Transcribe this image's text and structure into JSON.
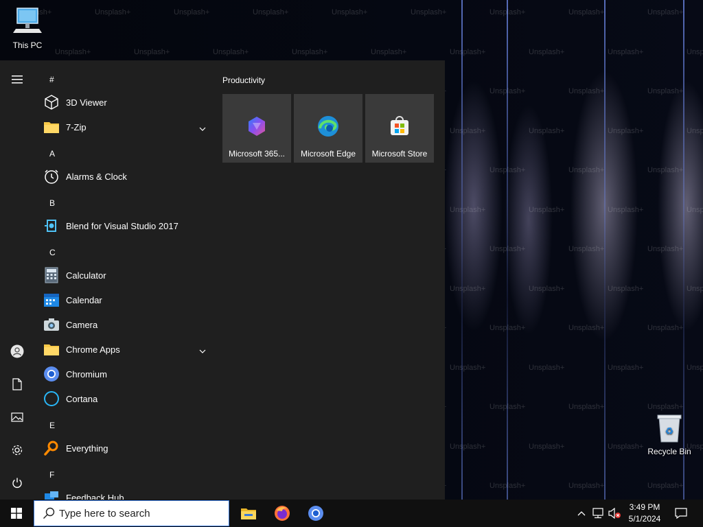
{
  "desktop": {
    "icons": [
      {
        "label": "This PC"
      },
      {
        "label": "Recycle Bin"
      }
    ],
    "watermark_text": "Unsplash+"
  },
  "start_menu": {
    "rail": [
      "hamburger-menu",
      "user-account",
      "documents",
      "pictures",
      "settings",
      "power"
    ],
    "apps": {
      "headers": [
        "#",
        "A",
        "B",
        "C",
        "E",
        "F"
      ],
      "items": [
        {
          "name": "3D Viewer",
          "icon": "cube-icon"
        },
        {
          "name": "7-Zip",
          "icon": "folder-icon",
          "expandable": true
        },
        {
          "name": "Alarms & Clock",
          "icon": "alarm-clock-icon"
        },
        {
          "name": "Blend for Visual Studio 2017",
          "icon": "blend-icon"
        },
        {
          "name": "Calculator",
          "icon": "calculator-icon"
        },
        {
          "name": "Calendar",
          "icon": "calendar-icon"
        },
        {
          "name": "Camera",
          "icon": "camera-icon"
        },
        {
          "name": "Chrome Apps",
          "icon": "folder-icon",
          "expandable": true
        },
        {
          "name": "Chromium",
          "icon": "chromium-icon"
        },
        {
          "name": "Cortana",
          "icon": "cortana-icon"
        },
        {
          "name": "Everything",
          "icon": "search-magnifier-icon"
        },
        {
          "name": "Feedback Hub",
          "icon": "feedback-hub-icon"
        }
      ]
    },
    "tiles": {
      "group": "Productivity",
      "items": [
        {
          "label": "Microsoft 365...",
          "icon": "microsoft-365-icon"
        },
        {
          "label": "Microsoft Edge",
          "icon": "edge-icon"
        },
        {
          "label": "Microsoft Store",
          "icon": "store-icon"
        }
      ]
    }
  },
  "taskbar": {
    "search_placeholder": "Type here to search",
    "pinned": [
      "file-explorer-icon",
      "firefox-icon",
      "chromium-icon"
    ],
    "clock": {
      "time": "3:49 PM",
      "date": "5/1/2024"
    },
    "tray": [
      "chevron-up-icon",
      "network-icon",
      "volume-muted-icon",
      "action-center-icon"
    ]
  },
  "colors": {
    "start_bg": "#1f1f1f",
    "tile_bg": "#3a3a3a",
    "taskbar_bg": "#101010",
    "accent": "#3b78d8"
  }
}
